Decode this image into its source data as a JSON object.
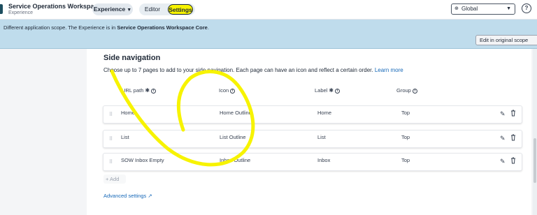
{
  "header": {
    "app_title": "Service Operations Workspace",
    "app_subtitle": "Experience",
    "experience_label": "Experience",
    "editor_label": "Editor",
    "settings_label": "Settings",
    "scope_value": "Global",
    "help_icon": "help-circle-icon",
    "scope_icon": "globe-icon"
  },
  "banner": {
    "text_plain": "Different application scope. The Experience is in ",
    "text_bold": "Service Operations Workspace Core",
    "text_end": ".",
    "button_label": "Edit in original scope",
    "color": "#bfdcec"
  },
  "section": {
    "title": "Side navigation",
    "description": "Choose up to 7 pages to add to your side navigation. Each page can have an icon and reflect a certain order.",
    "learn_more": "Learn more"
  },
  "columns": {
    "url_path": "URL path",
    "icon": "Icon",
    "label": "Label",
    "group": "Group",
    "required_mark": "✱",
    "info_mark": "i"
  },
  "rows": [
    {
      "url_path": "Home",
      "icon": "Home Outline",
      "label": "Home",
      "group": "Top"
    },
    {
      "url_path": "List",
      "icon": "List Outline",
      "label": "List",
      "group": "Top"
    },
    {
      "url_path": "SOW Inbox Empty",
      "icon": "Inbox Outline",
      "label": "Inbox",
      "group": "Top"
    }
  ],
  "actions": {
    "add_label": "+ Add",
    "advanced_settings": "Advanced settings"
  },
  "colors": {
    "highlight": "#f7f300",
    "link": "#1668b8"
  }
}
